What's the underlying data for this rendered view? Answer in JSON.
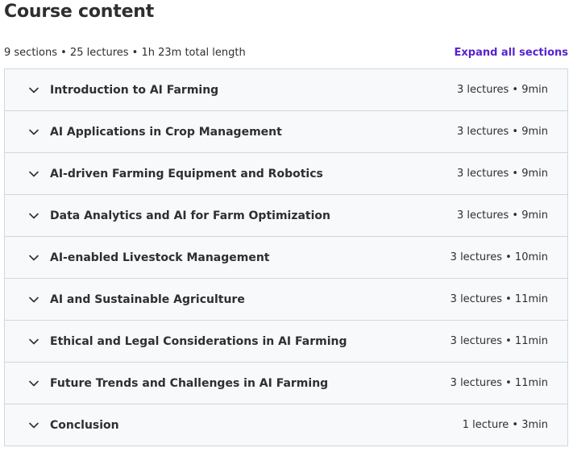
{
  "header": {
    "title": "Course content"
  },
  "summary": {
    "text": "9 sections • 25 lectures • 1h 23m total length",
    "expand_all_label": "Expand all sections"
  },
  "sections": [
    {
      "title": "Introduction to AI Farming",
      "meta": "3 lectures • 9min"
    },
    {
      "title": "AI Applications in Crop Management",
      "meta": "3 lectures • 9min"
    },
    {
      "title": "AI-driven Farming Equipment and Robotics",
      "meta": "3 lectures • 9min"
    },
    {
      "title": "Data Analytics and AI for Farm Optimization",
      "meta": "3 lectures • 9min"
    },
    {
      "title": "AI-enabled Livestock Management",
      "meta": "3 lectures • 10min"
    },
    {
      "title": "AI and Sustainable Agriculture",
      "meta": "3 lectures • 11min"
    },
    {
      "title": "Ethical and Legal Considerations in AI Farming",
      "meta": "3 lectures • 11min"
    },
    {
      "title": "Future Trends and Challenges in AI Farming",
      "meta": "3 lectures • 11min"
    },
    {
      "title": "Conclusion",
      "meta": "1 lecture • 3min"
    }
  ],
  "colors": {
    "accent": "#5624d0",
    "text": "#2d2f31",
    "section_bg": "#f7f9fa",
    "border": "#d1d7dc"
  },
  "icons": {
    "section_toggle": "chevron-down-icon"
  }
}
